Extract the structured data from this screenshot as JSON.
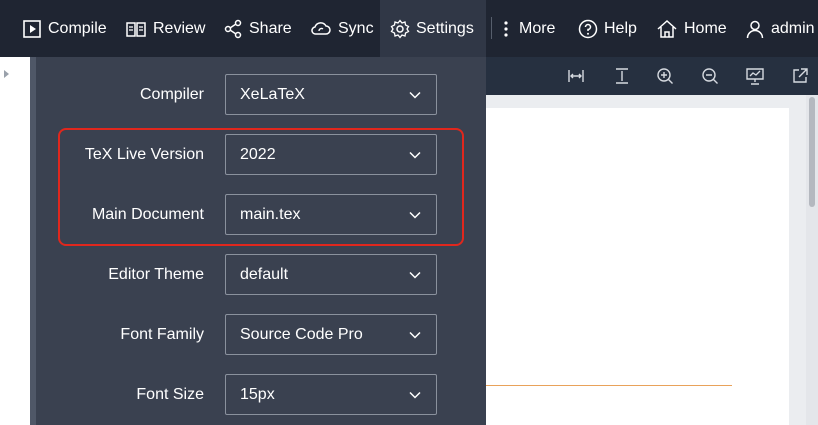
{
  "toolbar": {
    "compile": "Compile",
    "review": "Review",
    "share": "Share",
    "sync": "Sync",
    "settings": "Settings",
    "more": "More",
    "help": "Help",
    "home": "Home",
    "user": "admin",
    "icons": [
      "play-box-icon",
      "book-icon",
      "share-icon",
      "cloud-sync-icon",
      "gear-icon",
      "vertical-dots-icon",
      "help-circle-icon",
      "home-icon",
      "user-icon"
    ]
  },
  "pdf_toolbar": {
    "icons": [
      "fit-width-icon",
      "fit-height-icon",
      "zoom-in-icon",
      "zoom-out-icon",
      "presentation-icon",
      "open-external-icon"
    ]
  },
  "settings": {
    "rows": [
      {
        "label": "Compiler",
        "value": "XeLaTeX"
      },
      {
        "label": "TeX Live Version",
        "value": "2022"
      },
      {
        "label": "Main Document",
        "value": "main.tex"
      },
      {
        "label": "Editor Theme",
        "value": "default"
      },
      {
        "label": "Font Family",
        "value": "Source Code Pro"
      },
      {
        "label": "Font Size",
        "value": "15px"
      }
    ]
  },
  "colors": {
    "toolbar_bg": "#1f2532",
    "panel_bg": "#3a4150",
    "highlight": "#e0271d",
    "pdf_line": "#e9a25a"
  }
}
